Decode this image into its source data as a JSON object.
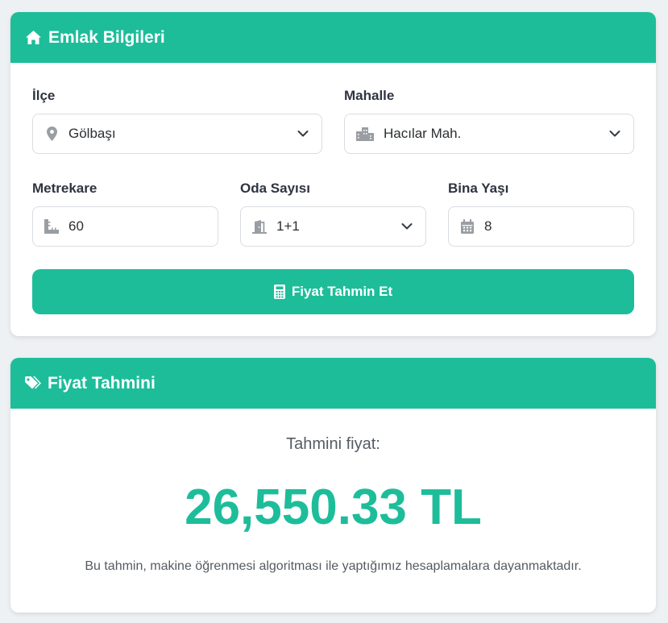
{
  "form_card": {
    "title": "Emlak Bilgileri",
    "icon": "home-icon",
    "district": {
      "label": "İlçe",
      "value": "Gölbaşı",
      "icon": "map-marker-icon"
    },
    "neighborhood": {
      "label": "Mahalle",
      "value": "Hacılar Mah.",
      "icon": "city-icon"
    },
    "area": {
      "label": "Metrekare",
      "value": "60",
      "icon": "ruler-icon"
    },
    "rooms": {
      "label": "Oda Sayısı",
      "value": "1+1",
      "icon": "door-open-icon"
    },
    "building_age": {
      "label": "Bina Yaşı",
      "value": "8",
      "icon": "calendar-icon"
    },
    "submit_label": "Fiyat Tahmin Et",
    "submit_icon": "calculator-icon"
  },
  "result_card": {
    "title": "Fiyat Tahmini",
    "icon": "tags-icon",
    "subtitle": "Tahmini fiyat:",
    "price": "26,550.33 TL",
    "note": "Bu tahmin, makine öğrenmesi algoritması ile yaptığımız hesaplamalara dayanmaktadır."
  },
  "colors": {
    "accent": "#1dbd9a",
    "background": "#eef1f3",
    "icon_gray": "#9a9ea3"
  }
}
